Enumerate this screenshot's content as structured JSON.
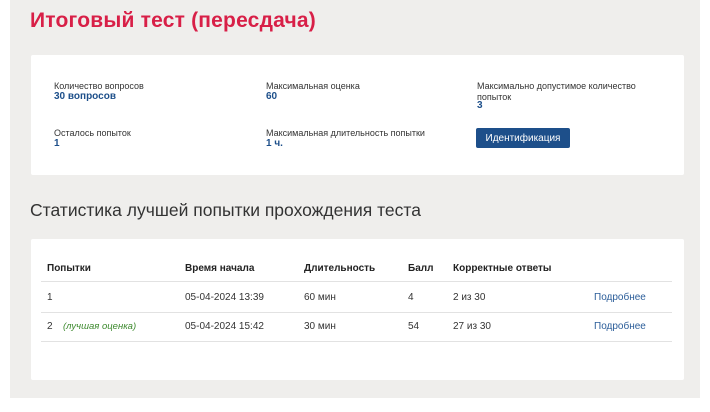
{
  "page": {
    "title": "Итоговый тест (пересдача)"
  },
  "info": {
    "questions": {
      "label": "Количество вопросов",
      "value": "30 вопросов"
    },
    "max_score": {
      "label": "Максимальная оценка",
      "value": "60"
    },
    "max_attempts": {
      "label_line1": "Максимально допустимое количество",
      "label_line2": "попыток",
      "value": "3"
    },
    "attempts_left": {
      "label": "Осталось попыток",
      "value": "1"
    },
    "max_duration": {
      "label": "Максимальная длительность попытки",
      "value": "1 ч."
    },
    "identify_button": "Идентификация"
  },
  "stats": {
    "title": "Статистика лучшей попытки прохождения теста",
    "columns": [
      "Попытки",
      "Время начала",
      "Длительность",
      "Балл",
      "Корректные ответы"
    ],
    "rows": [
      {
        "attempt": "1",
        "best": "",
        "start": "05-04-2024 13:39",
        "duration": "60 мин",
        "score": "4",
        "correct": "2 из 30",
        "link": "Подробнее"
      },
      {
        "attempt": "2",
        "best": "(лучшая оценка)",
        "start": "05-04-2024 15:42",
        "duration": "30 мин",
        "score": "54",
        "correct": "27 из 30",
        "link": "Подробнее"
      }
    ]
  },
  "colors": {
    "accent": "#d81f47",
    "primary": "#1d4f8a",
    "best": "#3d8a2e",
    "background": "#efeeec"
  }
}
